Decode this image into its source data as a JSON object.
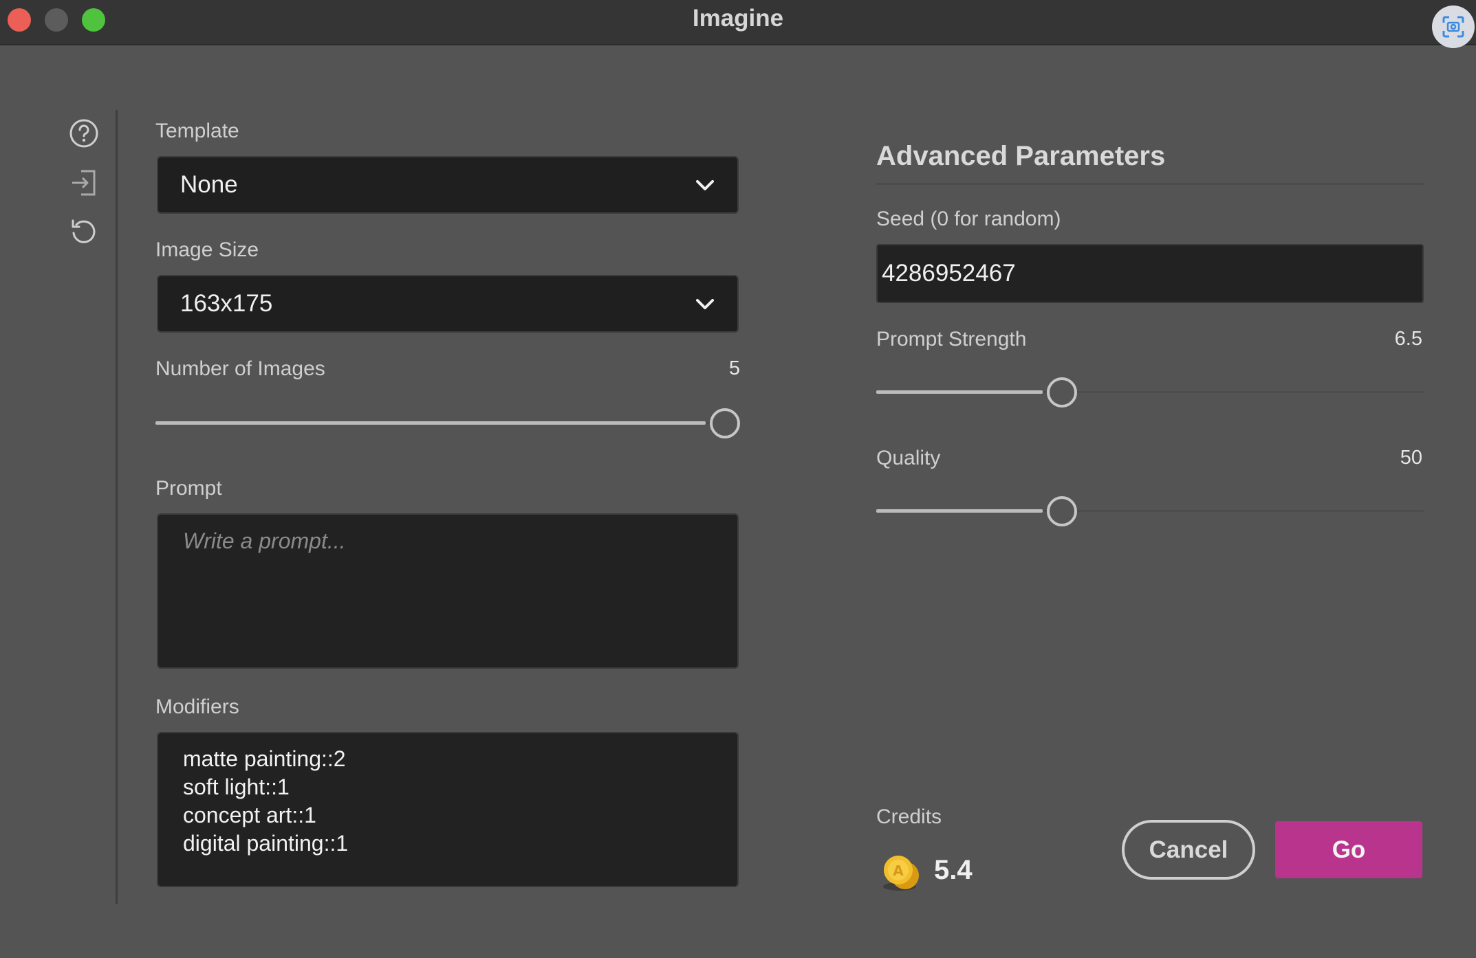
{
  "window": {
    "title": "Imagine"
  },
  "template": {
    "label": "Template",
    "selected": "None"
  },
  "image_size": {
    "label": "Image Size",
    "selected": "163x175"
  },
  "number_of_images": {
    "label": "Number of Images",
    "value": "5",
    "level": 1.0
  },
  "prompt": {
    "label": "Prompt",
    "placeholder": "Write a prompt..."
  },
  "modifiers": {
    "label": "Modifiers",
    "lines": [
      "matte painting::2",
      "soft light::1",
      "concept art::1",
      "digital painting::1"
    ]
  },
  "advanced": {
    "title": "Advanced Parameters",
    "seed": {
      "label": "Seed (0 for random)",
      "value": "4286952467"
    },
    "prompt_strength": {
      "label": "Prompt Strength",
      "value": "6.5",
      "level": 0.33
    },
    "quality": {
      "label": "Quality",
      "value": "50",
      "level": 0.33
    }
  },
  "credits": {
    "label": "Credits",
    "value": "5.4"
  },
  "buttons": {
    "cancel": "Cancel",
    "go": "Go"
  },
  "icons": {
    "help": "help-circle-icon",
    "import": "import-icon",
    "reset": "reset-icon",
    "screenshot": "screenshot-icon",
    "coin": "coin-icon",
    "chevron": "chevron-down-icon"
  },
  "colors": {
    "accent": "#b9348d",
    "close": "#ec5f57",
    "maximize": "#4fc23e"
  }
}
